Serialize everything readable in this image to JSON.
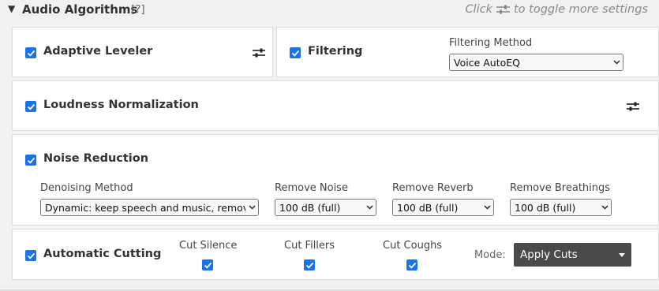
{
  "header": {
    "title": "Audio Algorithms",
    "help": "[?]",
    "hint_prefix": "Click",
    "hint_suffix": "to toggle more settings"
  },
  "adaptive_leveler": {
    "label": "Adaptive Leveler",
    "checked": true
  },
  "filtering": {
    "label": "Filtering",
    "checked": true,
    "method_label": "Filtering Method",
    "method_value": "Voice AutoEQ"
  },
  "loudness": {
    "label": "Loudness Normalization",
    "checked": true
  },
  "noise_reduction": {
    "label": "Noise Reduction",
    "checked": true,
    "denoising": {
      "label": "Denoising Method",
      "value": "Dynamic: keep speech and music, remove everything else"
    },
    "remove_noise": {
      "label": "Remove Noise",
      "value": "100 dB (full)"
    },
    "remove_reverb": {
      "label": "Remove Reverb",
      "value": "100 dB (full)"
    },
    "remove_breathings": {
      "label": "Remove Breathings",
      "value": "100 dB (full)"
    }
  },
  "automatic_cutting": {
    "label": "Automatic Cutting",
    "checked": true,
    "cut_silence": {
      "label": "Cut Silence",
      "checked": true
    },
    "cut_fillers": {
      "label": "Cut Fillers",
      "checked": true
    },
    "cut_coughs": {
      "label": "Cut Coughs",
      "checked": true
    },
    "mode_label": "Mode:",
    "mode_value": "Apply Cuts"
  },
  "colors": {
    "accent": "#1a73e8",
    "dark_select": "#4a4a4a",
    "panel_border": "#dcdcdc"
  }
}
